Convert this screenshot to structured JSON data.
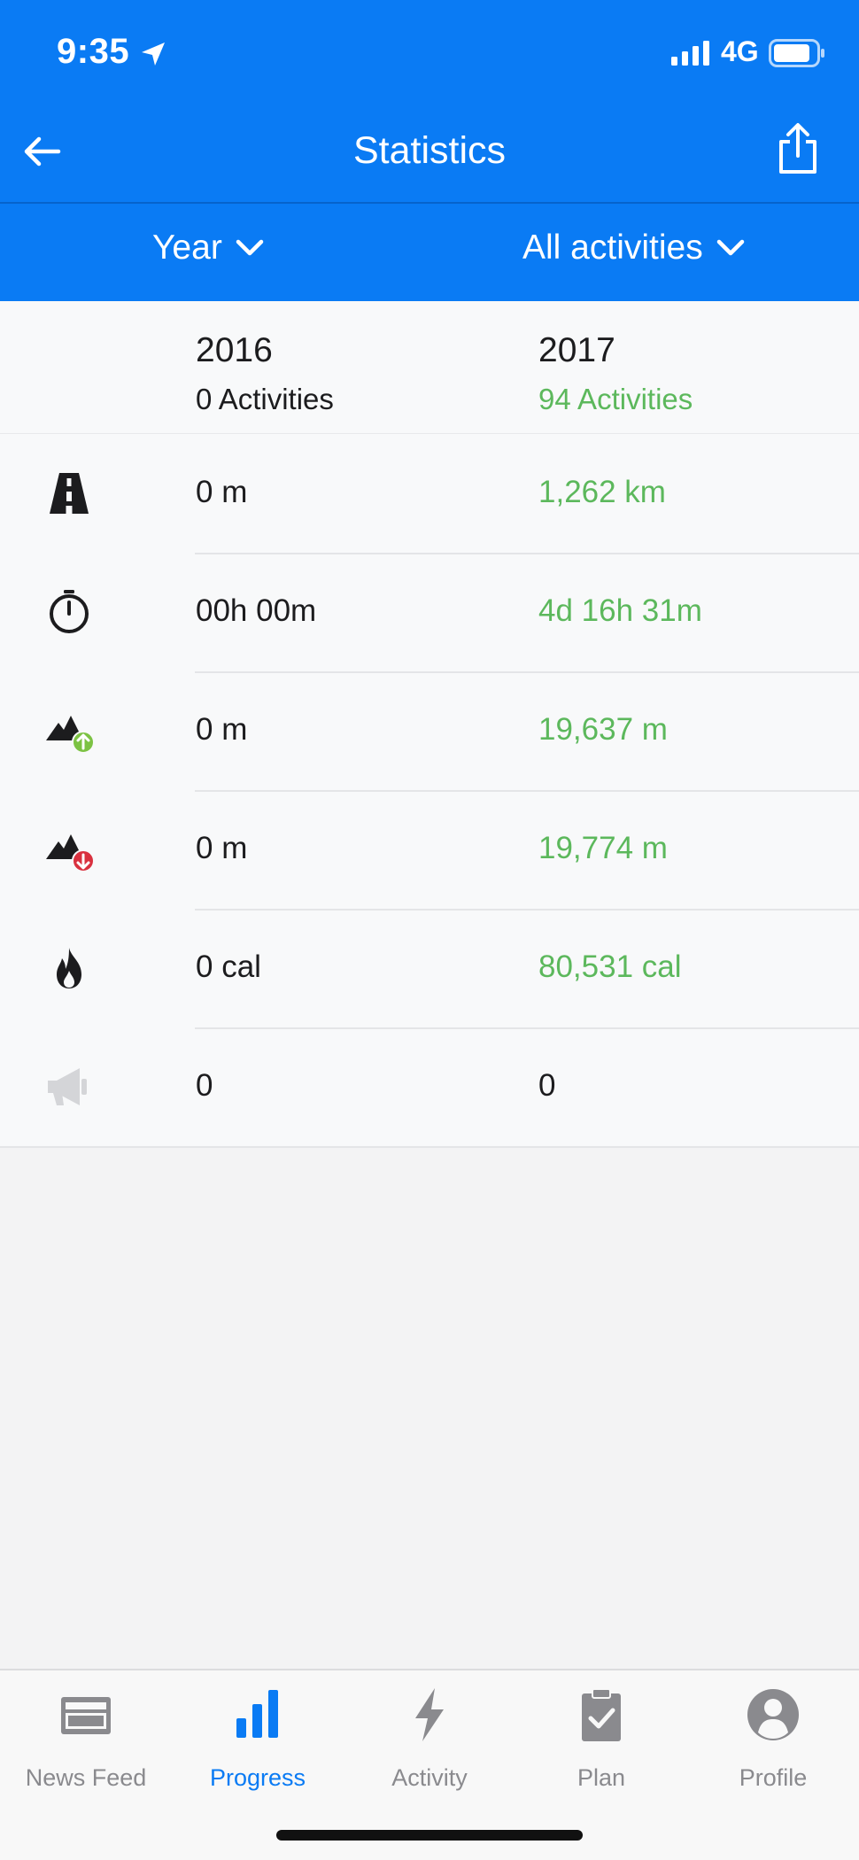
{
  "status_bar": {
    "time": "9:35",
    "network": "4G"
  },
  "nav": {
    "title": "Statistics"
  },
  "filters": {
    "period": "Year",
    "activity": "All activities"
  },
  "stats": {
    "columns": [
      {
        "year": "2016",
        "count": "0 Activities"
      },
      {
        "year": "2017",
        "count": "94 Activities"
      }
    ],
    "rows": [
      {
        "icon": "road-icon",
        "a": "0 m",
        "b": "1,262 km"
      },
      {
        "icon": "stopwatch-icon",
        "a": "00h 00m",
        "b": "4d 16h 31m"
      },
      {
        "icon": "elevation-gain-icon",
        "a": "0 m",
        "b": "19,637 m"
      },
      {
        "icon": "elevation-loss-icon",
        "a": "0 m",
        "b": "19,774 m"
      },
      {
        "icon": "flame-icon",
        "a": "0 cal",
        "b": "80,531 cal"
      },
      {
        "icon": "megaphone-icon",
        "a": "0",
        "b": "0"
      }
    ]
  },
  "tabs": [
    {
      "label": "News Feed",
      "icon": "newspaper-icon"
    },
    {
      "label": "Progress",
      "icon": "bar-chart-icon",
      "active": true
    },
    {
      "label": "Activity",
      "icon": "lightning-icon"
    },
    {
      "label": "Plan",
      "icon": "clipboard-check-icon"
    },
    {
      "label": "Profile",
      "icon": "person-icon"
    }
  ],
  "colors": {
    "brand_blue": "#0a7bf4",
    "positive_green": "#5cb85c",
    "loss_red": "#d9313f",
    "gain_green": "#7cc243"
  }
}
